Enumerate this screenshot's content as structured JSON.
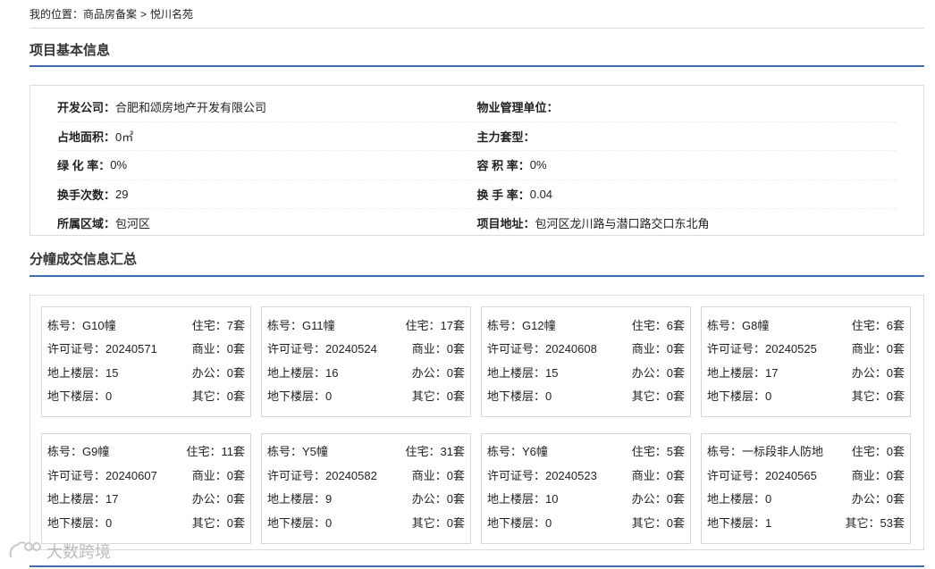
{
  "breadcrumb": {
    "prefix": "我的位置：",
    "items": [
      "商品房备案",
      "悦川名苑"
    ],
    "separator": ">"
  },
  "project_section": {
    "title": "项目基本信息"
  },
  "info": [
    [
      {
        "label": "开发公司：",
        "value": "合肥和颂房地产开发有限公司"
      },
      {
        "label": "物业管理单位：",
        "value": ""
      }
    ],
    [
      {
        "label": "占地面积：",
        "value": "0㎡"
      },
      {
        "label": "主力套型：",
        "value": ""
      }
    ],
    [
      {
        "label": "绿 化 率：",
        "value": "0%"
      },
      {
        "label": "容 积 率：",
        "value": "0%"
      }
    ],
    [
      {
        "label": "换手次数：",
        "value": "29"
      },
      {
        "label": "换 手 率：",
        "value": "0.04"
      }
    ],
    [
      {
        "label": "所属区域：",
        "value": "包河区"
      },
      {
        "label": "项目地址：",
        "value": "包河区龙川路与潜口路交口东北角"
      }
    ]
  ],
  "building_section": {
    "title": "分幢成交信息汇总"
  },
  "buildings": [
    {
      "rows": [
        [
          "栋号：G10幢",
          "住宅：7套"
        ],
        [
          "许可证号：20240571",
          "商业：0套"
        ],
        [
          "地上楼层：15",
          "办公：0套"
        ],
        [
          "地下楼层：0",
          "其它：0套"
        ]
      ]
    },
    {
      "rows": [
        [
          "栋号：G11幢",
          "住宅：17套"
        ],
        [
          "许可证号：20240524",
          "商业：0套"
        ],
        [
          "地上楼层：16",
          "办公：0套"
        ],
        [
          "地下楼层：0",
          "其它：0套"
        ]
      ]
    },
    {
      "rows": [
        [
          "栋号：G12幢",
          "住宅：6套"
        ],
        [
          "许可证号：20240608",
          "商业：0套"
        ],
        [
          "地上楼层：15",
          "办公：0套"
        ],
        [
          "地下楼层：0",
          "其它：0套"
        ]
      ]
    },
    {
      "rows": [
        [
          "栋号：G8幢",
          "住宅：6套"
        ],
        [
          "许可证号：20240525",
          "商业：0套"
        ],
        [
          "地上楼层：17",
          "办公：0套"
        ],
        [
          "地下楼层：0",
          "其它：0套"
        ]
      ]
    },
    {
      "rows": [
        [
          "栋号：G9幢",
          "住宅：11套"
        ],
        [
          "许可证号：20240607",
          "商业：0套"
        ],
        [
          "地上楼层：17",
          "办公：0套"
        ],
        [
          "地下楼层：0",
          "其它：0套"
        ]
      ]
    },
    {
      "rows": [
        [
          "栋号：Y5幢",
          "住宅：31套"
        ],
        [
          "许可证号：20240582",
          "商业：0套"
        ],
        [
          "地上楼层：9",
          "办公：0套"
        ],
        [
          "地下楼层：0",
          "其它：0套"
        ]
      ]
    },
    {
      "rows": [
        [
          "栋号：Y6幢",
          "住宅：5套"
        ],
        [
          "许可证号：20240523",
          "商业：0套"
        ],
        [
          "地上楼层：10",
          "办公：0套"
        ],
        [
          "地下楼层：0",
          "其它：0套"
        ]
      ]
    },
    {
      "rows": [
        [
          "栋号：一标段非人防地",
          "住宅：0套"
        ],
        [
          "许可证号：20240565",
          "商业：0套"
        ],
        [
          "地上楼层：0",
          "办公：0套"
        ],
        [
          "地下楼层：1",
          "其它：53套"
        ]
      ]
    }
  ],
  "watermark": {
    "text": "大数跨境",
    "icon": "watermark-logo-icon"
  },
  "colors": {
    "accent": "#3d6db5",
    "border": "#dcdcdc"
  }
}
